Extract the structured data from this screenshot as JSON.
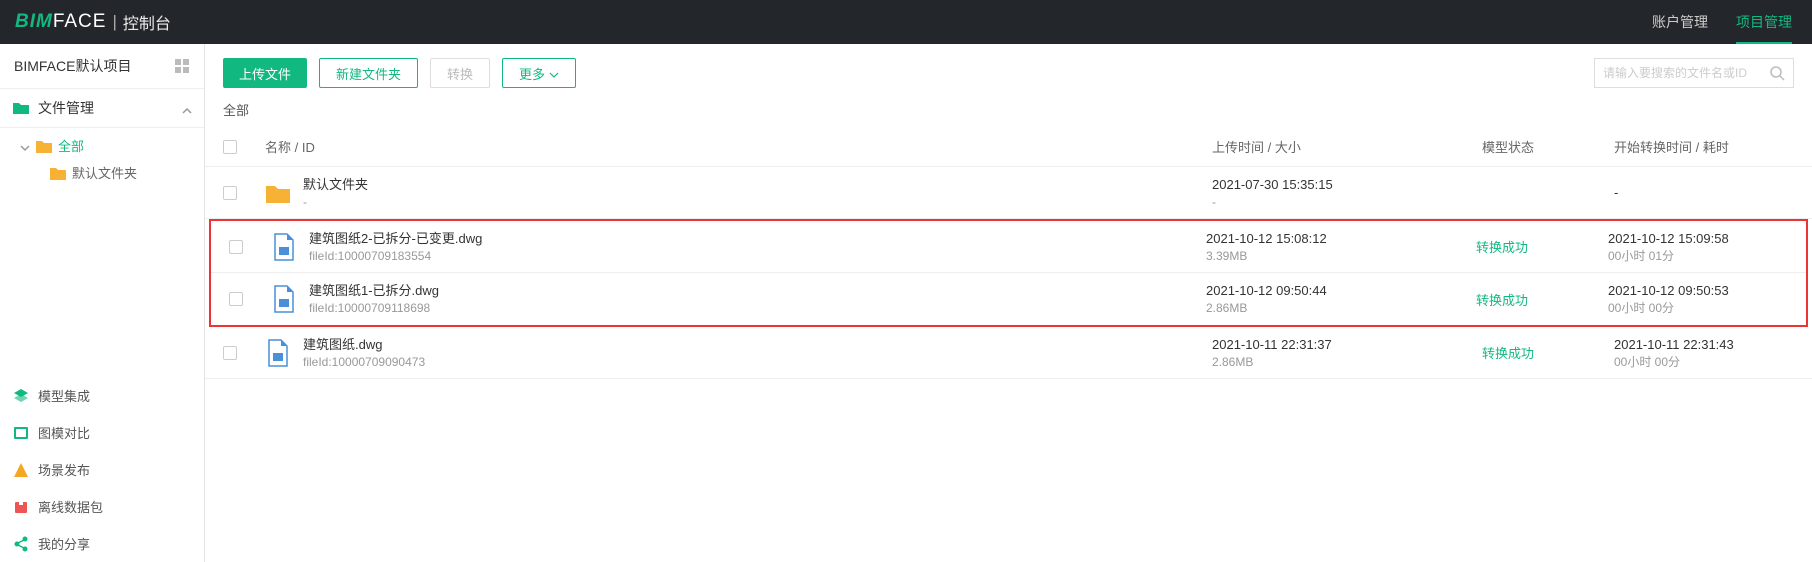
{
  "header": {
    "logo_bim": "BIM",
    "logo_face": "FACE",
    "logo_sub": "控制台",
    "nav": {
      "account": "账户管理",
      "project": "项目管理"
    }
  },
  "sidebar": {
    "project_title": "BIMFACE默认项目",
    "file_mgmt": "文件管理",
    "tree": {
      "all": "全部",
      "default_folder": "默认文件夹"
    },
    "menu": {
      "model_integrate": "模型集成",
      "drawing_compare": "图模对比",
      "scene_publish": "场景发布",
      "offline_pack": "离线数据包",
      "my_share": "我的分享"
    }
  },
  "toolbar": {
    "upload": "上传文件",
    "new_folder": "新建文件夹",
    "convert": "转换",
    "more": "更多",
    "search_placeholder": "请输入要搜索的文件名或ID"
  },
  "breadcrumb": "全部",
  "columns": {
    "name": "名称 / ID",
    "upload": "上传时间 / 大小",
    "status": "模型状态",
    "convert": "开始转换时间 / 耗时"
  },
  "rows": [
    {
      "type": "folder",
      "name": "默认文件夹",
      "sub": "-",
      "upload_time": "2021-07-30 15:35:15",
      "upload_size": "-",
      "status": "",
      "convert_time": "-",
      "convert_dur": ""
    },
    {
      "type": "file",
      "name": "建筑图纸2-已拆分-已变更.dwg",
      "sub": "fileId:10000709183554",
      "upload_time": "2021-10-12 15:08:12",
      "upload_size": "3.39MB",
      "status": "转换成功",
      "convert_time": "2021-10-12 15:09:58",
      "convert_dur": "00小时 01分"
    },
    {
      "type": "file",
      "name": "建筑图纸1-已拆分.dwg",
      "sub": "fileId:10000709118698",
      "upload_time": "2021-10-12 09:50:44",
      "upload_size": "2.86MB",
      "status": "转换成功",
      "convert_time": "2021-10-12 09:50:53",
      "convert_dur": "00小时 00分"
    },
    {
      "type": "file",
      "name": "建筑图纸.dwg",
      "sub": "fileId:10000709090473",
      "upload_time": "2021-10-11 22:31:37",
      "upload_size": "2.86MB",
      "status": "转换成功",
      "convert_time": "2021-10-11 22:31:43",
      "convert_dur": "00小时 00分"
    }
  ]
}
